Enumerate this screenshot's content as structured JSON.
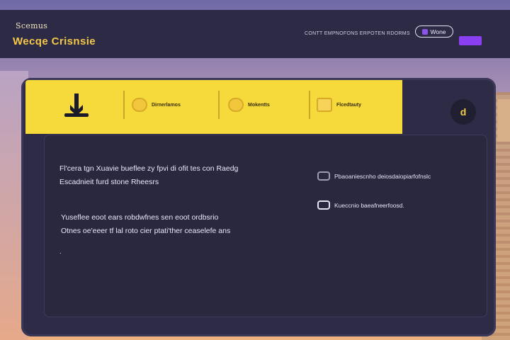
{
  "header": {
    "brand_small": "Scemus",
    "brand_title": "Wecqe Crisnsie",
    "meta_text": "CONTT EMPNOFONS ERPOTEN RDORMS",
    "pill_label": "Wone",
    "accent_color": "#8a3ff0"
  },
  "tabs": [
    {
      "label": "Dirnerlamos",
      "icon": "medal-icon"
    },
    {
      "label": "Mokentts",
      "icon": "coin-icon"
    },
    {
      "label": "Flcedtauty",
      "icon": "box-icon"
    }
  ],
  "side_button_label": "d",
  "main": {
    "para1_line1": "Fl'cera tgn Xuavie bueflee zy fpvi di ofit tes con Raedg",
    "para1_line2": "Escadnieit furd stone Rheesrs",
    "para2_line1": "Yuseflee eoot ears robdwfnes sen eoot ordbsrio",
    "para2_line2": "Otnes oe'eeer tf lal roto cier ptati'ther ceaselefe ans",
    "bullet": "."
  },
  "options": [
    {
      "label": "Pbaoaniescnho deiosdaiopiarfofnslc",
      "checked": false
    },
    {
      "label": "Kueccnio baeafneerfoosd.",
      "checked": false
    }
  ]
}
